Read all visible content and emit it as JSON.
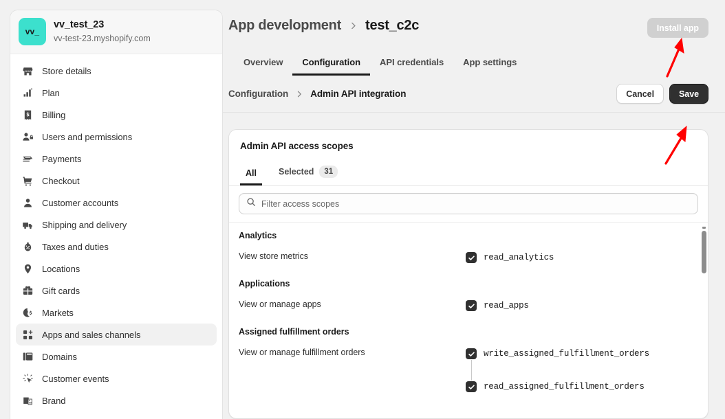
{
  "store": {
    "logo_text": "vv_",
    "name": "vv_test_23",
    "domain": "vv-test-23.myshopify.com",
    "logo_color": "#3ce0cd"
  },
  "sidebar": {
    "items": [
      {
        "label": "Store details",
        "icon": "store-icon",
        "active": false
      },
      {
        "label": "Plan",
        "icon": "plan-icon",
        "active": false
      },
      {
        "label": "Billing",
        "icon": "billing-icon",
        "active": false
      },
      {
        "label": "Users and permissions",
        "icon": "users-icon",
        "active": false
      },
      {
        "label": "Payments",
        "icon": "payments-icon",
        "active": false
      },
      {
        "label": "Checkout",
        "icon": "checkout-cart-icon",
        "active": false
      },
      {
        "label": "Customer accounts",
        "icon": "customer-icon",
        "active": false
      },
      {
        "label": "Shipping and delivery",
        "icon": "shipping-truck-icon",
        "active": false
      },
      {
        "label": "Taxes and duties",
        "icon": "taxes-icon",
        "active": false
      },
      {
        "label": "Locations",
        "icon": "location-pin-icon",
        "active": false
      },
      {
        "label": "Gift cards",
        "icon": "gift-card-icon",
        "active": false
      },
      {
        "label": "Markets",
        "icon": "markets-globe-icon",
        "active": false
      },
      {
        "label": "Apps and sales channels",
        "icon": "apps-grid-icon",
        "active": true
      },
      {
        "label": "Domains",
        "icon": "domains-icon",
        "active": false
      },
      {
        "label": "Customer events",
        "icon": "customer-events-icon",
        "active": false
      },
      {
        "label": "Brand",
        "icon": "brand-image-icon",
        "active": false
      }
    ]
  },
  "header": {
    "breadcrumb_parent": "App development",
    "breadcrumb_separator": "›",
    "breadcrumb_current": "test_c2c",
    "install_button": "Install app",
    "install_button_disabled": true
  },
  "tabs": [
    {
      "label": "Overview",
      "active": false
    },
    {
      "label": "Configuration",
      "active": true
    },
    {
      "label": "API credentials",
      "active": false
    },
    {
      "label": "App settings",
      "active": false
    }
  ],
  "subbar": {
    "breadcrumb_parent": "Configuration",
    "breadcrumb_separator": "›",
    "breadcrumb_current": "Admin API integration",
    "cancel_label": "Cancel",
    "save_label": "Save"
  },
  "card": {
    "title": "Admin API access scopes",
    "tabs": [
      {
        "label": "All",
        "badge": null,
        "active": true
      },
      {
        "label": "Selected",
        "badge": "31",
        "active": false
      }
    ],
    "search_placeholder": "Filter access scopes",
    "search_value": "",
    "groups": [
      {
        "title": "Analytics",
        "rows": [
          {
            "description": "View store metrics",
            "scopes": [
              {
                "name": "read_analytics",
                "checked": true
              }
            ]
          }
        ]
      },
      {
        "title": "Applications",
        "rows": [
          {
            "description": "View or manage apps",
            "scopes": [
              {
                "name": "read_apps",
                "checked": true
              }
            ]
          }
        ]
      },
      {
        "title": "Assigned fulfillment orders",
        "rows": [
          {
            "description": "View or manage fulfillment orders",
            "scopes": [
              {
                "name": "write_assigned_fulfillment_orders",
                "checked": true
              },
              {
                "name": "read_assigned_fulfillment_orders",
                "checked": true
              }
            ]
          }
        ]
      }
    ]
  },
  "annotations": {
    "color": "#ff0000",
    "arrows": [
      {
        "name": "arrow-pointing-install-app"
      },
      {
        "name": "arrow-pointing-save"
      }
    ]
  }
}
